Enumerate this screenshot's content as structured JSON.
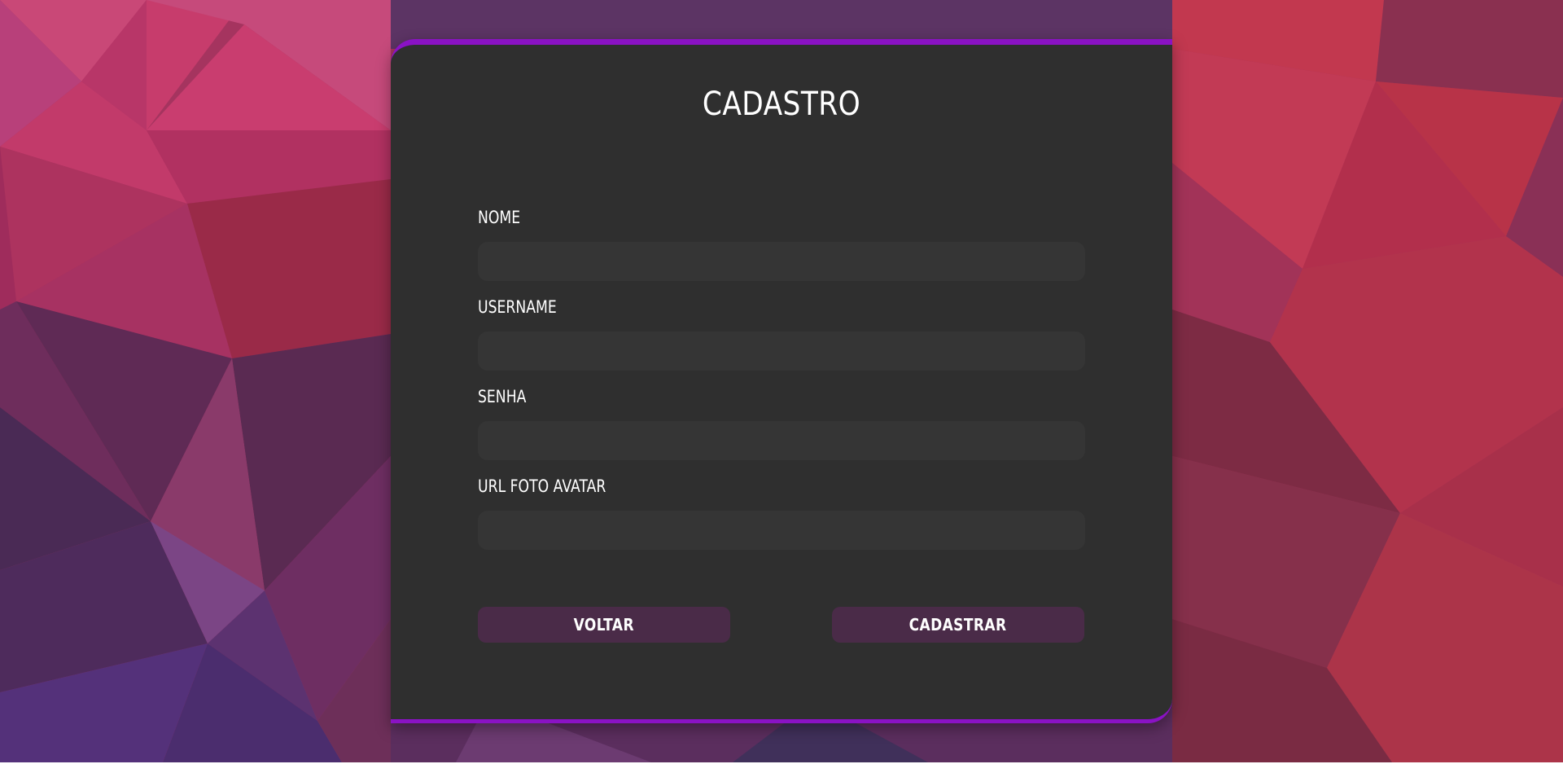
{
  "form": {
    "title": "CADASTRO",
    "fields": [
      {
        "label": "NOME",
        "value": ""
      },
      {
        "label": "USERNAME",
        "value": ""
      },
      {
        "label": "SENHA",
        "value": ""
      },
      {
        "label": "URL FOTO AVATAR",
        "value": ""
      }
    ],
    "buttons": {
      "back": "VOLTAR",
      "submit": "CADASTRAR"
    }
  },
  "colors": {
    "card_background": "#2f2f2f",
    "accent_border": "#8a12c4",
    "input_background": "#353535",
    "button_background": "#4a2b48",
    "text": "#ffffff"
  }
}
